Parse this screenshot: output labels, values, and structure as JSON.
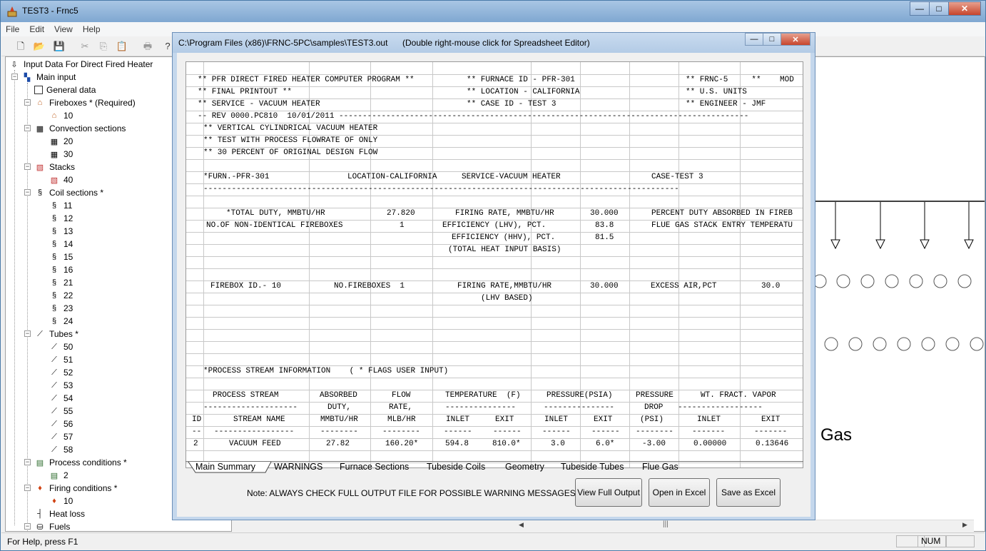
{
  "window": {
    "title": "TEST3 - Frnc5",
    "min": "—",
    "max": "□",
    "close": "✕"
  },
  "menu": [
    "File",
    "Edit",
    "View",
    "Help"
  ],
  "tree": {
    "root": "Input Data For Direct Fired Heater",
    "main_input": "Main input",
    "general_data": "General data",
    "fireboxes": "Fireboxes * (Required)",
    "firebox_items": [
      "10"
    ],
    "convection": "Convection sections",
    "convection_items": [
      "20",
      "30"
    ],
    "stacks": "Stacks",
    "stack_items": [
      "40"
    ],
    "coils": "Coil sections *",
    "coil_items": [
      "11",
      "12",
      "13",
      "14",
      "15",
      "16",
      "21",
      "22",
      "23",
      "24"
    ],
    "tubes": "Tubes *",
    "tube_items": [
      "50",
      "51",
      "52",
      "53",
      "54",
      "55",
      "56",
      "57",
      "58"
    ],
    "process": "Process conditions *",
    "process_items": [
      "2"
    ],
    "firing": "Firing conditions *",
    "firing_items": [
      "10"
    ],
    "heat_loss": "Heat loss",
    "fuels": "Fuels"
  },
  "diagram": {
    "label": "Gas"
  },
  "child": {
    "title": "C:\\Program Files (x86)\\FRNC-5PC\\samples\\TEST3.out",
    "hint": "(Double right-mouse click for Spreadsheet Editor)",
    "footer_note": "Note:  ALWAYS CHECK FULL OUTPUT FILE FOR POSSIBLE WARNING MESSAGES.",
    "buttons": {
      "view_full": "View Full Output",
      "open_excel": "Open in Excel",
      "save_excel": "Save as Excel"
    },
    "tabs": [
      "Main Summary",
      "WARNINGS",
      "Furnace Sections",
      "Tubeside Coils",
      "Geometry",
      "Tubeside Tubes",
      "Flue Gas"
    ]
  },
  "sheet": {
    "lines": {
      "h1": "** PFR DIRECT FIRED HEATER COMPUTER PROGRAM **",
      "h2": "** FURNACE ID - PFR-301",
      "h3": "** FRNC-5     **    MOD",
      "h4": "** FINAL PRINTOUT **",
      "h5": "** LOCATION - CALIFORNIA",
      "h6": "** U.S. UNITS",
      "h7": "** SERVICE - VACUUM HEATER",
      "h8": "** CASE ID - TEST 3",
      "h9": "** ENGINEER - JMF",
      "rev": "-- REV 0000.PC810  10/01/2011 ---------------------------------------------------------------------------------------",
      "c1": "** VERTICAL CYLINDRICAL VACUUM HEATER",
      "c2": "** TEST WITH PROCESS FLOWRATE OF ONLY",
      "c3": "** 30 PERCENT OF ORIGINAL DESIGN FLOW",
      "furn": "*FURN.-PFR-301",
      "loc": "LOCATION-CALIFORNIA",
      "serv": "SERVICE-VACUUM HEATER",
      "case": "CASE-TEST 3",
      "dash2": "-----------------------------------------------------------------------------------------------------",
      "total_duty_lbl": "*TOTAL DUTY, MMBTU/HR",
      "total_duty": "27.820",
      "firing_rate_lbl": "FIRING RATE, MMBTU/HR",
      "firing_rate": "30.000",
      "pct_duty_lbl": "PERCENT DUTY ABSORBED IN FIREB",
      "nonid_lbl": "NO.OF NON-IDENTICAL FIREBOXES",
      "nonid": "1",
      "eff_lhv_lbl": "EFFICIENCY (LHV), PCT.",
      "eff_lhv": "83.8",
      "flue_lbl": "FLUE GAS STACK ENTRY TEMPERATU",
      "eff_hhv_lbl": "EFFICIENCY (HHV), PCT.",
      "eff_hhv": "81.5",
      "basis": "(TOTAL HEAT INPUT BASIS)",
      "fb_id": "FIREBOX ID.- 10",
      "fb_no": "NO.FIREBOXES  1",
      "fb_rate_lbl": "FIRING RATE,MMBTU/HR",
      "fb_rate": "30.000",
      "excess_lbl": "EXCESS AIR,PCT",
      "excess": "30.0",
      "lhv_based": "(LHV BASED)",
      "proc_info": "*PROCESS STREAM INFORMATION    ( * FLAGS USER INPUT)"
    },
    "table_head1": [
      "PROCESS STREAM",
      "ABSORBED",
      "FLOW",
      "TEMPERATURE  (F)",
      "PRESSURE(PSIA)",
      "PRESSURE",
      "WT. FRACT. VAPOR"
    ],
    "table_head2": [
      "--------------------",
      "DUTY,",
      "RATE,",
      "---------------",
      "---------------",
      "DROP",
      "------------------"
    ],
    "table_head3": [
      "ID",
      "STREAM NAME",
      "MMBTU/HR",
      "MLB/HR",
      "INLET",
      "EXIT",
      "INLET",
      "EXIT",
      "(PSI)",
      "INLET",
      "EXIT"
    ],
    "table_dash": [
      "--",
      "-----------------",
      "--------",
      "--------",
      "------",
      "------",
      "------",
      "------",
      "--------",
      "-------",
      "-------"
    ],
    "table_row": [
      "2",
      "VACUUM FEED",
      "27.82",
      "160.20*",
      "594.8",
      "810.0*",
      "3.0",
      "6.0*",
      "-3.00",
      "0.00000",
      "0.13646"
    ]
  },
  "status": {
    "help": "For Help, press F1",
    "num": "NUM"
  }
}
